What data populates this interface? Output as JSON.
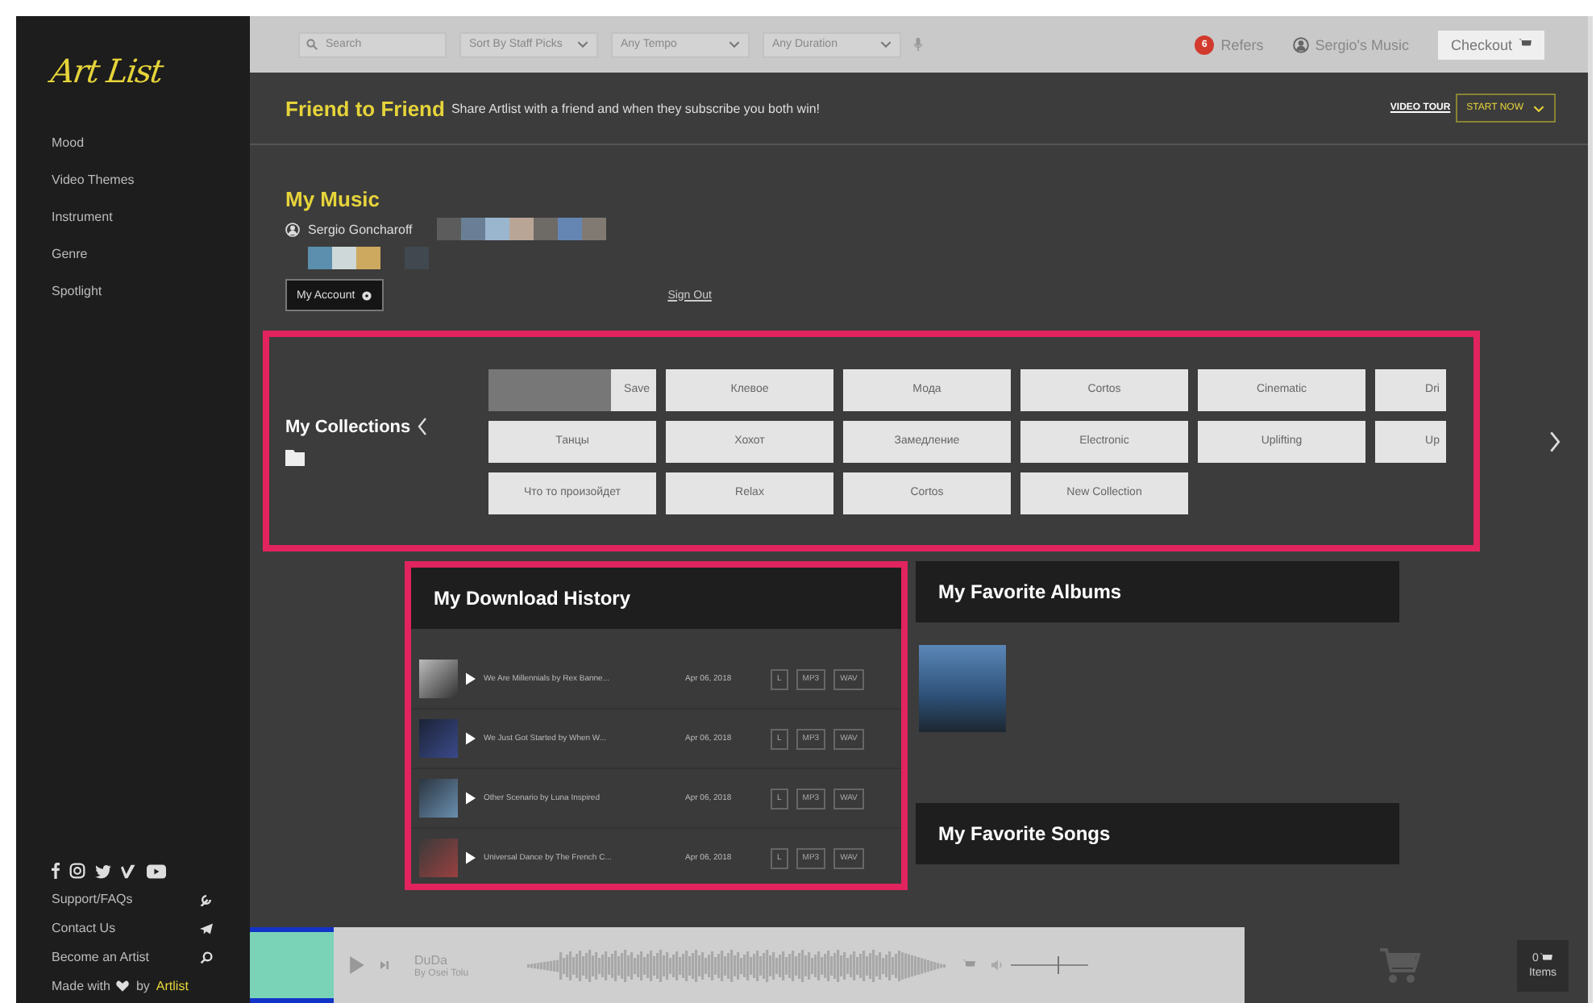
{
  "sidebar": {
    "logo": "Art List",
    "nav": [
      "Mood",
      "Video Themes",
      "Instrument",
      "Genre",
      "Spotlight"
    ],
    "footer_links": [
      "Support/FAQs",
      "Contact Us",
      "Become an Artist"
    ],
    "made_with": "Made with",
    "by": "by",
    "brand": "Artlist"
  },
  "topbar": {
    "search": {
      "placeholder": "Search"
    },
    "filters": [
      "Sort By Staff Picks",
      "Any Tempo",
      "Any Duration"
    ],
    "refers_badge": "6",
    "refers": "Refers",
    "user": "Sergio's Music",
    "checkout": "Checkout"
  },
  "banner": {
    "title": "Friend to Friend",
    "text": "Share Artlist with a friend and when they subscribe you both win!",
    "video_tour": "VIDEO TOUR",
    "start_now": "START NOW"
  },
  "my_music": {
    "title": "My Music",
    "user": "Sergio Goncharoff",
    "account": "My Account",
    "sign_out": "Sign Out"
  },
  "collections": {
    "title": "My Collections",
    "items": [
      {
        "label": "Save",
        "kind": "cover"
      },
      {
        "label": "Клевое",
        "kind": "plain"
      },
      {
        "label": "Мода",
        "kind": "plain"
      },
      {
        "label": "Cortos",
        "kind": "plain"
      },
      {
        "label": "Cinematic",
        "kind": "plain"
      },
      {
        "label": "Dri",
        "kind": "plain"
      },
      {
        "label": "Танцы",
        "kind": "plain"
      },
      {
        "label": "Хохот",
        "kind": "plain"
      },
      {
        "label": "Замедление",
        "kind": "plain"
      },
      {
        "label": "Electronic",
        "kind": "plain"
      },
      {
        "label": "Uplifting",
        "kind": "plain"
      },
      {
        "label": "Up",
        "kind": "plain"
      },
      {
        "label": "Что то произойдет",
        "kind": "plain"
      },
      {
        "label": "Relax",
        "kind": "plain"
      },
      {
        "label": "Cortos",
        "kind": "plain"
      },
      {
        "label": "New Collection",
        "kind": "plain"
      }
    ]
  },
  "download_history": {
    "title": "My Download History",
    "rows": [
      {
        "title": "We Are Millennials by Rex Banne...",
        "date": "Apr 06, 2018",
        "formats": [
          "L",
          "MP3",
          "WAV"
        ]
      },
      {
        "title": "We Just Got Started by When W...",
        "date": "Apr 06, 2018",
        "formats": [
          "L",
          "MP3",
          "WAV"
        ]
      },
      {
        "title": "Other Scenario by Luna Inspired",
        "date": "Apr 06, 2018",
        "formats": [
          "L",
          "MP3",
          "WAV"
        ]
      },
      {
        "title": "Universal Dance by The French C...",
        "date": "Apr 06, 2018",
        "formats": [
          "L",
          "MP3",
          "WAV"
        ]
      }
    ]
  },
  "favorite_albums": {
    "title": "My Favorite Albums"
  },
  "favorite_songs": {
    "title": "My Favorite Songs"
  },
  "player": {
    "track": "DuDa",
    "artist": "By Osei Tolu",
    "volume": {
      "level": 0.6
    },
    "cart": {
      "count": "0",
      "label": "Items"
    }
  }
}
